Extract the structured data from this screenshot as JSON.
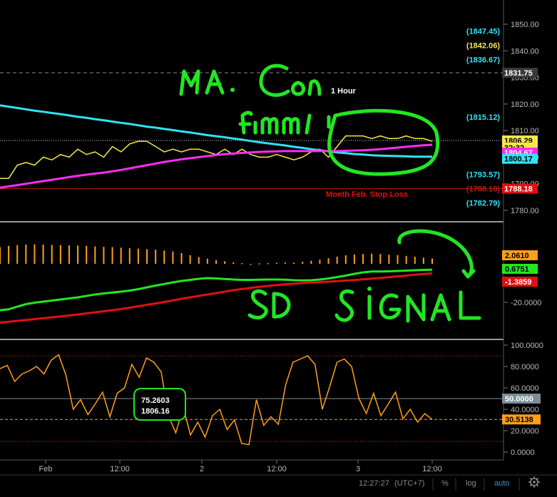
{
  "toolbar": {
    "time": "12:27:27",
    "timezone": "(UTC+7)",
    "percent": "%",
    "log": "log",
    "auto": "auto"
  },
  "annotations": {
    "timeframe": "1 Hour",
    "stop_loss": "Month Feb. Stop Loss",
    "handwritten_top": "MA. Con firm",
    "handwritten_mid": "SD SIGNAL",
    "tooltip_value1": "75.2603",
    "tooltip_value2": "1806.16"
  },
  "colors": {
    "background": "#000000",
    "yellow": "#f5e84a",
    "cyan": "#2ee4f5",
    "magenta": "#ff2cf5",
    "red": "#ff1a1a",
    "green": "#22e622",
    "orange": "#ff9f1a",
    "stop_loss": "#e01010"
  },
  "chart_data": [
    {
      "type": "line",
      "panel": "price",
      "y_ticks": [
        "1850.00",
        "1840.00",
        "1830.00",
        "1820.00",
        "1810.00",
        "1800.00",
        "1790.00",
        "1780.00"
      ],
      "ylim": [
        1776,
        1854
      ],
      "x_ticks": [
        "Feb",
        "12:00",
        "2",
        "12:00",
        "3",
        "12:00"
      ],
      "series": [
        {
          "name": "price",
          "color": "#f5e84a",
          "values": [
            1792,
            1792,
            1797,
            1798,
            1797,
            1800,
            1799,
            1801,
            1800,
            1803,
            1801,
            1802,
            1800,
            1804,
            1802,
            1805,
            1806,
            1806,
            1804,
            1802,
            1803,
            1802,
            1803,
            1803,
            1802,
            1801,
            1803,
            1801,
            1803,
            1801,
            1800,
            1800,
            1801,
            1800,
            1799,
            1800,
            1802,
            1803,
            1800,
            1804,
            1808,
            1808,
            1808,
            1807,
            1808,
            1807,
            1807,
            1808,
            1807,
            1807,
            1806
          ]
        },
        {
          "name": "ma_cyan",
          "color": "#2ee4f5",
          "values": [
            1819.5,
            1819.0,
            1818.5,
            1818.0,
            1817.5,
            1817.1,
            1816.6,
            1816.2,
            1815.7,
            1815.2,
            1814.8,
            1814.3,
            1813.9,
            1813.4,
            1812.9,
            1812.5,
            1812.0,
            1811.5,
            1811.1,
            1810.6,
            1810.2,
            1809.7,
            1809.3,
            1808.8,
            1808.3,
            1807.9,
            1807.5,
            1807.0,
            1806.6,
            1806.1,
            1805.6,
            1805.2,
            1804.8,
            1804.4,
            1803.9,
            1803.5,
            1803.0,
            1802.6,
            1802.2,
            1801.8,
            1801.5,
            1801.2,
            1801.0,
            1800.7,
            1800.6,
            1800.5,
            1800.4,
            1800.3,
            1800.2,
            1800.2,
            1800.17
          ]
        },
        {
          "name": "ma_magenta",
          "color": "#ff2cf5",
          "values": [
            1788.5,
            1789,
            1789.5,
            1790,
            1790.5,
            1791,
            1791.5,
            1792,
            1792.5,
            1793,
            1793.4,
            1793.8,
            1794.2,
            1794.7,
            1795.2,
            1795.8,
            1796.4,
            1797,
            1797.6,
            1798.2,
            1798.7,
            1799.2,
            1799.6,
            1800,
            1800.4,
            1800.8,
            1801.1,
            1801.4,
            1801.6,
            1801.8,
            1802.0,
            1802.1,
            1802.2,
            1802.3,
            1802.3,
            1802.3,
            1802.3,
            1802.3,
            1802.3,
            1802.3,
            1802.4,
            1802.5,
            1802.6,
            1802.8,
            1803,
            1803.3,
            1803.6,
            1803.9,
            1804.2,
            1804.5,
            1804.67
          ]
        }
      ],
      "price_labels": [
        {
          "text": "(1847.45)",
          "color": "#2ee4f5",
          "value": 1847.45
        },
        {
          "text": "(1842.06)",
          "color": "#f5e84a",
          "value": 1842.06
        },
        {
          "text": "(1836.67)",
          "color": "#2ee4f5",
          "value": 1836.67
        },
        {
          "text": "(1815.12)",
          "color": "#2ee4f5",
          "value": 1815.12
        },
        {
          "text": "(1793.57)",
          "color": "#2ee4f5",
          "value": 1793.57
        },
        {
          "text": "(1788.18)",
          "color": "#b02020",
          "value": 1788.18
        },
        {
          "text": "(1782.79)",
          "color": "#2ee4f5",
          "value": 1782.79
        }
      ],
      "axis_badges": [
        {
          "text": "1831.75",
          "bg": "#3a3a3a",
          "fg": "#ffffff",
          "value": 1831.75
        },
        {
          "text": "1806.29",
          "bg": "#f5e84a",
          "fg": "#000000",
          "value": 1806.29
        },
        {
          "text": "32:32",
          "bg": "#f5e84a",
          "fg": "#000000",
          "value": 1803.6
        },
        {
          "text": "1804.67",
          "bg": "#ff2cf5",
          "fg": "#ffffff",
          "value": 1801.7
        },
        {
          "text": "1800.17",
          "bg": "#2ee4f5",
          "fg": "#000000",
          "value": 1799.4
        },
        {
          "text": "1788.18",
          "bg": "#e01010",
          "fg": "#ffffff",
          "value": 1788.18
        }
      ],
      "stop_loss": 1788.18,
      "resistance": 1831.75
    },
    {
      "type": "bar",
      "panel": "macd",
      "y_ticks": [
        "-20.0000"
      ],
      "badges": [
        {
          "text": "2.0610",
          "bg": "#ff9f1a",
          "fg": "#000000"
        },
        {
          "text": "0.6751",
          "bg": "#22e622",
          "fg": "#000000"
        },
        {
          "text": "-1.3859",
          "bg": "#e01010",
          "fg": "#ffffff"
        }
      ],
      "histogram": [
        -6.5,
        -7,
        -7.3,
        -7.5,
        -7.6,
        -7.5,
        -7.4,
        -7.3,
        -7.2,
        -7.1,
        -7,
        -6.8,
        -6.6,
        -6.5,
        -6.3,
        -6.1,
        -5.9,
        -5.7,
        -5.5,
        -5.2,
        -4.8,
        -4.2,
        -3.4,
        -2.6,
        -2,
        -1.4,
        -1,
        -0.6,
        -0.3,
        0,
        0.2,
        0.3,
        0.4,
        0.5,
        0.5,
        0.8,
        1.2,
        1.6,
        2.2,
        2.8,
        3.3,
        3.6,
        3.8,
        3.9,
        3.8,
        3.6,
        3.4,
        3.1,
        2.8,
        2.4,
        2.06
      ],
      "series": [
        {
          "name": "signal",
          "color": "#22e622",
          "values": [
            -22,
            -21.5,
            -20,
            -18.6,
            -17.8,
            -17.2,
            -16.6,
            -16,
            -15.4,
            -14.8,
            -14,
            -13.2,
            -12.6,
            -12.1,
            -11.6,
            -11,
            -10.2,
            -9.2,
            -8.2,
            -7.3,
            -6.4,
            -5.6,
            -5,
            -4.4,
            -4,
            -4.2,
            -4.5,
            -4.8,
            -5,
            -5,
            -4.9,
            -4.8,
            -4.8,
            -4.9,
            -5.2,
            -5.3,
            -5.2,
            -4.8,
            -4.2,
            -3.4,
            -2.6,
            -1.6,
            -0.8,
            -0.3,
            -0.3,
            -0.2,
            0,
            0.2,
            0.4,
            0.6,
            0.6751
          ]
        },
        {
          "name": "macd",
          "color": "#e01010",
          "values": [
            -29,
            -28.5,
            -28,
            -27.5,
            -27,
            -26.5,
            -26,
            -25.5,
            -25,
            -24.4,
            -23.8,
            -23.2,
            -22.6,
            -22,
            -21.3,
            -20.6,
            -19.8,
            -19,
            -18.2,
            -17.4,
            -16.5,
            -15.6,
            -14.8,
            -14,
            -13.2,
            -12.4,
            -11.6,
            -10.8,
            -10.1,
            -9.5,
            -8.9,
            -8.4,
            -7.9,
            -7.5,
            -7.1,
            -6.8,
            -6.5,
            -6.2,
            -6,
            -5.7,
            -5.4,
            -5.1,
            -4.7,
            -4.3,
            -3.9,
            -3.5,
            -3.0,
            -2.6,
            -2.1,
            -1.7,
            -1.3859
          ]
        }
      ]
    },
    {
      "type": "line",
      "panel": "stochastic",
      "y_ticks": [
        "100.0000",
        "80.0000",
        "60.0000",
        "40.0000",
        "20.0000",
        "0.0000"
      ],
      "ylim": [
        -3,
        103
      ],
      "levels": [
        90,
        50,
        10
      ],
      "badges": [
        {
          "text": "50.0000",
          "bg": "#7a8e9a",
          "fg": "#ffffff",
          "value": 50
        },
        {
          "text": "30.5138",
          "bg": "#ff9f1a",
          "fg": "#000000",
          "value": 30.5138
        }
      ],
      "series": [
        {
          "name": "stoch",
          "color": "#ff9f1a",
          "values": [
            78,
            81,
            66,
            73,
            76,
            80,
            73,
            86,
            91,
            72,
            40,
            49,
            35,
            45,
            56,
            33,
            55,
            60,
            82,
            70,
            88,
            84,
            75,
            34,
            18,
            42,
            16,
            28,
            14,
            34,
            40,
            21,
            30,
            8,
            7,
            49,
            25,
            33,
            26,
            63,
            84,
            87,
            90,
            82,
            40,
            61,
            84,
            87,
            80,
            50,
            36,
            55,
            34,
            45,
            56,
            31,
            40,
            28,
            36,
            30.5
          ]
        }
      ],
      "tooltip": {
        "values": [
          "75.2603",
          "1806.16"
        ]
      }
    }
  ]
}
